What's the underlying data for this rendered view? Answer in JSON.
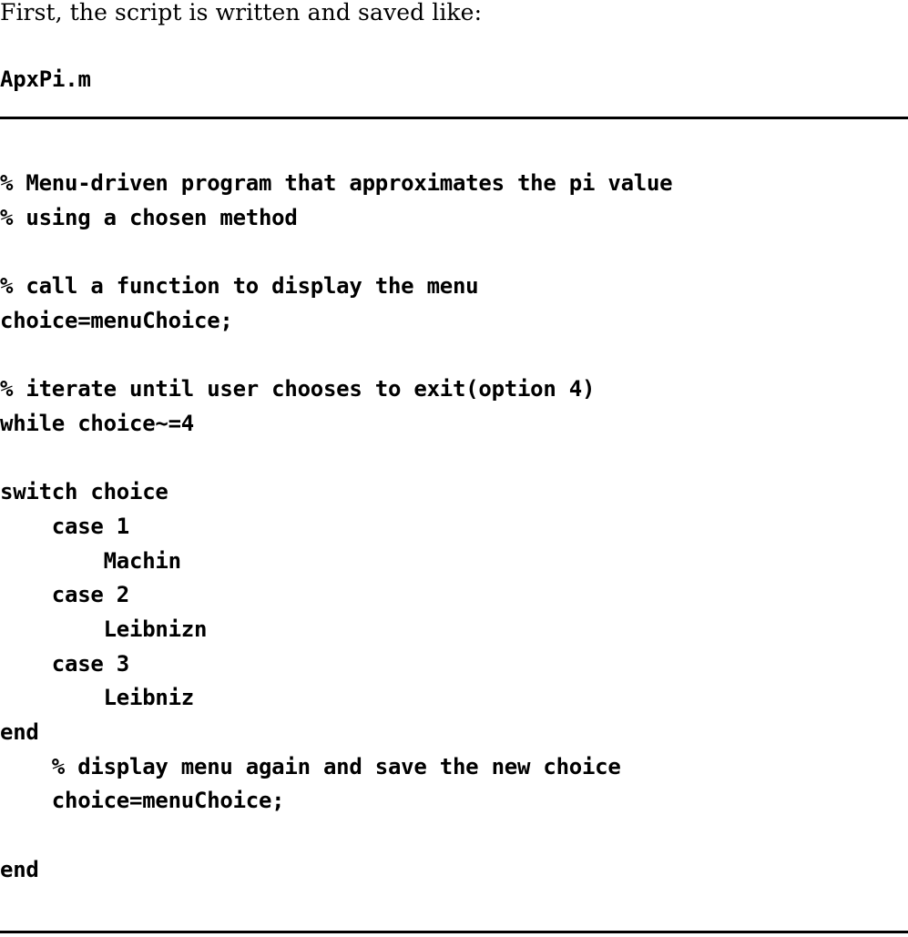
{
  "document": {
    "intro_text": "First, the script is written and saved like:",
    "filename": "ApxPi.m",
    "rules": {
      "top": "horizontal-rule",
      "bottom": "horizontal-rule"
    }
  },
  "listing": {
    "language": "matlab",
    "lines": [
      "% Menu-driven program that approximates the pi value",
      "% using a chosen method",
      "",
      "% call a function to display the menu",
      "choice=menuChoice;",
      "",
      "% iterate until user chooses to exit(option 4)",
      "while choice~=4",
      "",
      "switch choice",
      "    case 1",
      "        Machin",
      "    case 2",
      "        Leibnizn",
      "    case 3",
      "        Leibniz",
      "end",
      "    % display menu again and save the new choice",
      "    choice=menuChoice;",
      "",
      "end"
    ]
  }
}
